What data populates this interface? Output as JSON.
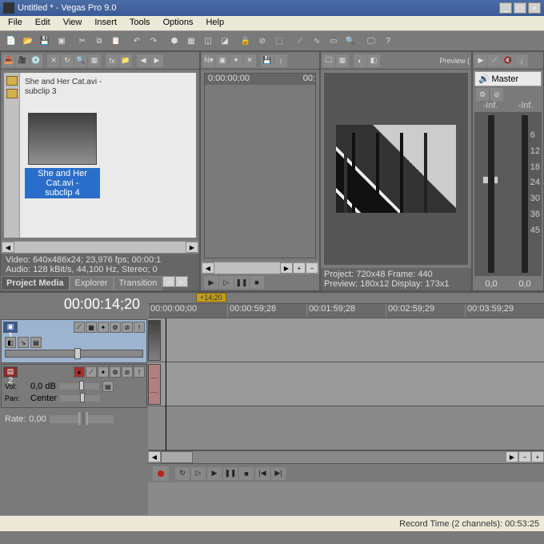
{
  "window": {
    "title": "Untitled * - Vegas Pro 9.0"
  },
  "menu": [
    "File",
    "Edit",
    "View",
    "Insert",
    "Tools",
    "Options",
    "Help"
  ],
  "media": {
    "clip1_name": "She and Her Cat.avi -",
    "clip1_sub": "subclip 3",
    "clip_sel_name": "She and Her Cat.avi -",
    "clip_sel_sub": "subclip 4",
    "info_video": "Video: 640x486x24; 23,976 fps; 00:00:1",
    "info_audio": "Audio: 128 kBit/s, 44,100 Hz, Stereo; 0",
    "tab_active": "Project Media",
    "tab2": "Explorer",
    "tab3": "Transition"
  },
  "trimmer": {
    "start": "0:00:00;00",
    "end": "00:"
  },
  "preview": {
    "title": "Preview (",
    "line1": "Project:   720x48  Frame:    440",
    "line2": "Preview:  180x12  Display:  173x1"
  },
  "master": {
    "label": "Master",
    "scale": [
      "-Inf.",
      "-Inf."
    ],
    "ticks": [
      "6",
      "12",
      "18",
      "24",
      "30",
      "36",
      "45"
    ],
    "out_l": "0,0",
    "out_r": "0,0"
  },
  "timecode": "00:00:14;20",
  "marker": "+14;20",
  "ruler": [
    "00:00:00;00",
    "00:00:59;28",
    "00:01:59;28",
    "00:02:59;29",
    "00:03:59;29"
  ],
  "track_v": {
    "num": "1"
  },
  "track_a": {
    "num": "2",
    "vol_lbl": "Vol:",
    "vol_val": "0,0 dB",
    "pan_lbl": "Pan:",
    "pan_val": "Center"
  },
  "rate": {
    "label": "Rate:",
    "value": "0,00"
  },
  "status": "Record Time (2 channels): 00:53:25"
}
